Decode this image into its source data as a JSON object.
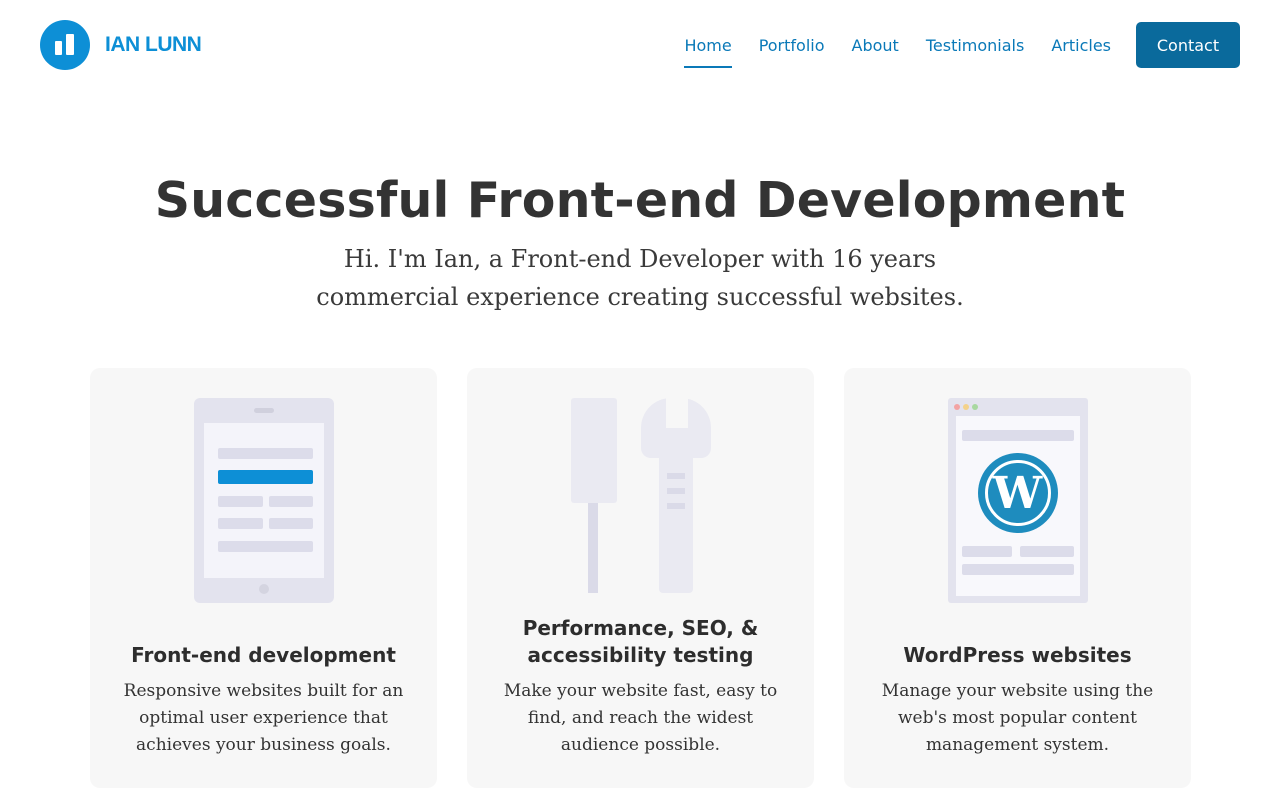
{
  "header": {
    "logo_text": "IAN LUNN",
    "logo_icon": "bar-chart-circle-icon",
    "brand_color": "#0d8fd6",
    "nav": [
      {
        "label": "Home",
        "active": true
      },
      {
        "label": "Portfolio",
        "active": false
      },
      {
        "label": "About",
        "active": false
      },
      {
        "label": "Testimonials",
        "active": false
      },
      {
        "label": "Articles",
        "active": false
      }
    ],
    "contact_label": "Contact",
    "contact_color": "#0a6a9c"
  },
  "hero": {
    "title": "Successful Front-end Development",
    "subtitle_line1": "Hi. I'm Ian, a Front-end Developer with 16 years",
    "subtitle_line2": "commercial experience creating successful websites."
  },
  "cards": [
    {
      "title": "Front-end development",
      "description": "Responsive websites built for an optimal user experience that achieves your business goals.",
      "icon": "tablet-layout-icon"
    },
    {
      "title_line1": "Performance, SEO, &",
      "title_line2": "accessibility testing",
      "description": "Make your website fast, easy to find, and reach the widest audience possible.",
      "icon": "tools-icon"
    },
    {
      "title": "WordPress websites",
      "description": "Manage your website using the web's most popular content management system.",
      "icon": "wordpress-icon"
    }
  ]
}
